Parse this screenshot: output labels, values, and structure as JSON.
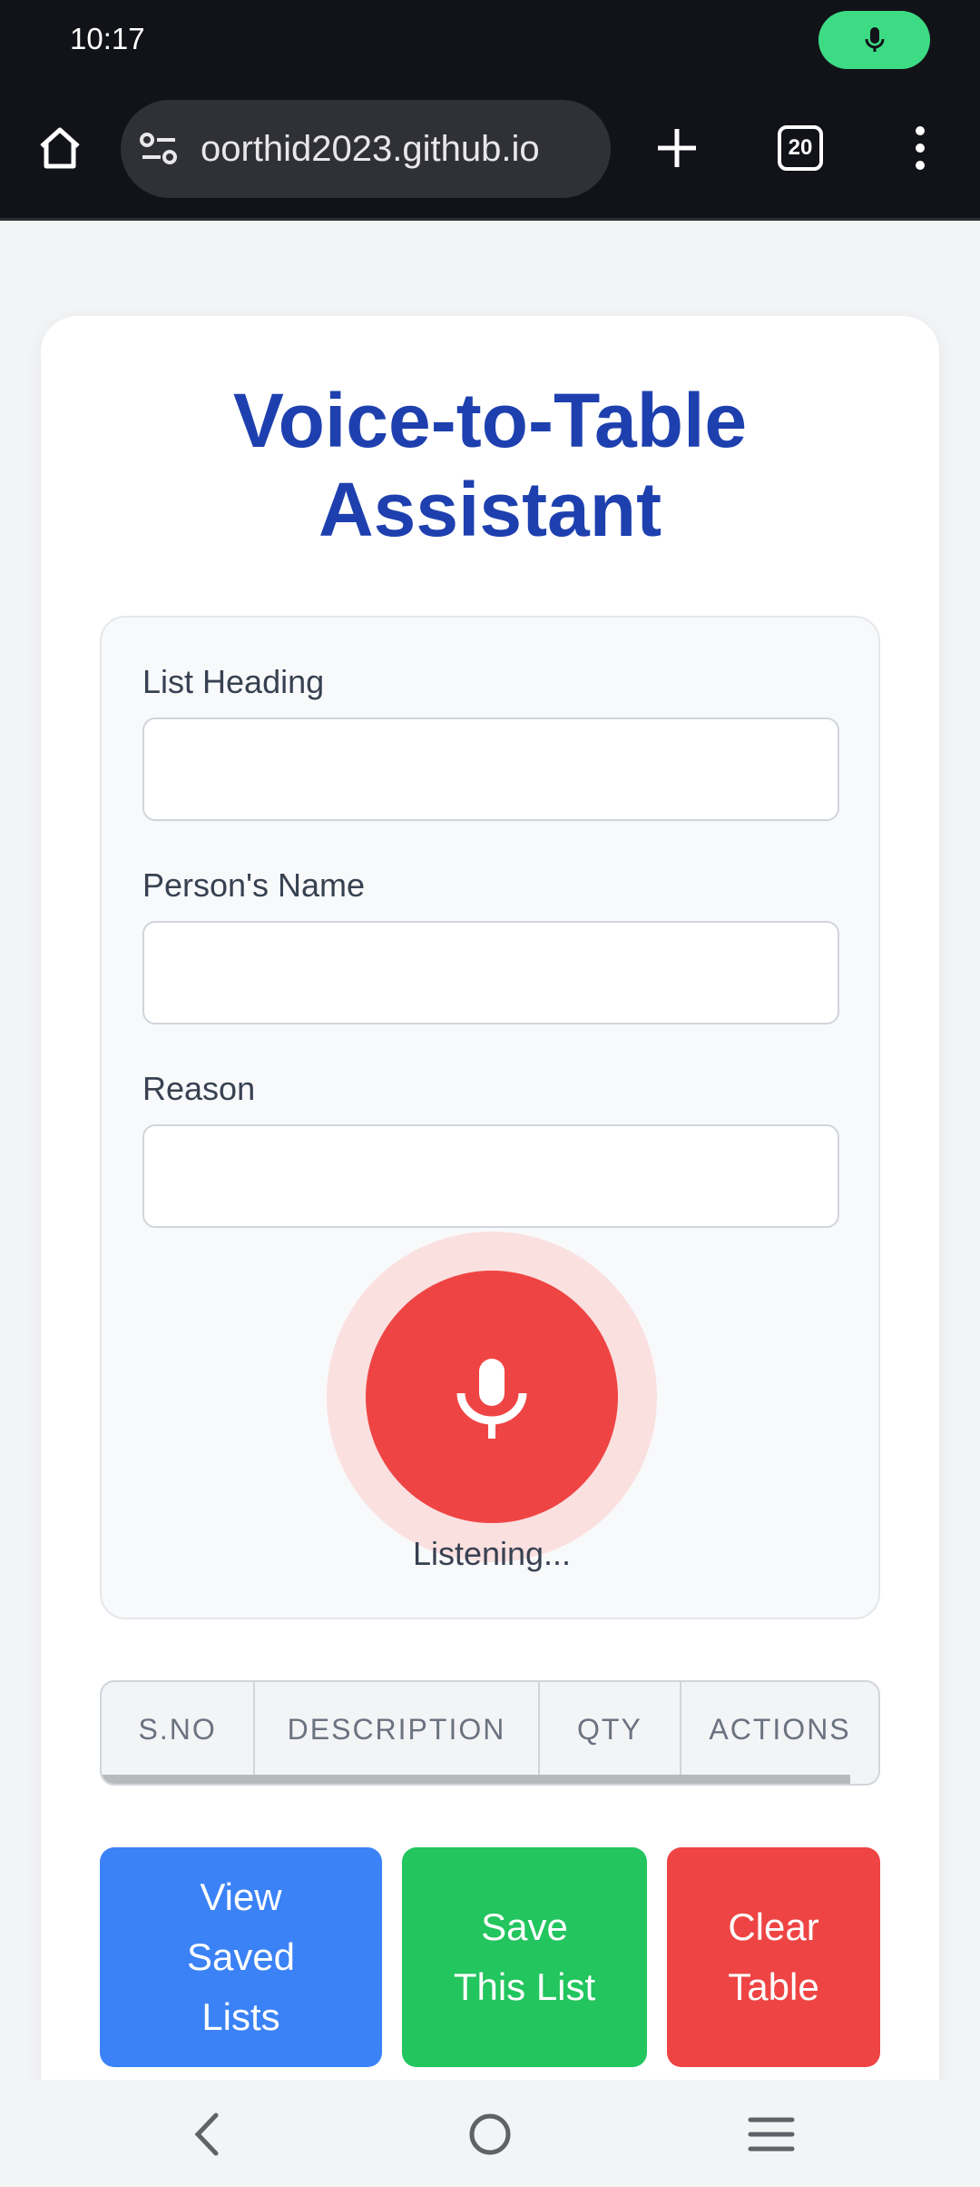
{
  "status_bar": {
    "time": "10:17",
    "mic_indicator_icon": "microphone-icon",
    "mic_indicator_color": "#3ddc84"
  },
  "browser": {
    "home_icon": "home-icon",
    "site_settings_icon": "tune-icon",
    "url": "oorthid2023.github.io",
    "new_tab_icon": "plus-icon",
    "tab_count": "20",
    "menu_icon": "more-vert-icon"
  },
  "app": {
    "title_line1": "Voice-to-Table",
    "title_line2": "Assistant",
    "title_color": "#1e40af",
    "fields": {
      "list_heading": {
        "label": "List Heading",
        "value": ""
      },
      "person_name": {
        "label": "Person's Name",
        "value": ""
      },
      "reason": {
        "label": "Reason",
        "value": ""
      }
    },
    "mic_button_icon": "microphone-icon",
    "mic_button_color": "#ef4444",
    "status_text": "Listening...",
    "table": {
      "columns": [
        "S.NO",
        "DESCRIPTION",
        "QTY",
        "ACTIONS"
      ],
      "rows": []
    },
    "buttons": {
      "view_saved": {
        "lines": [
          "View",
          "Saved",
          "Lists"
        ],
        "color": "#3b82f6"
      },
      "save_list": {
        "lines": [
          "Save",
          "This List"
        ],
        "color": "#22c55e"
      },
      "clear_table": {
        "lines": [
          "Clear",
          "Table"
        ],
        "color": "#ef4444"
      }
    }
  },
  "nav_bar": {
    "back_icon": "back-chevron-icon",
    "home_icon": "circle-home-icon",
    "recents_icon": "recents-lines-icon"
  }
}
